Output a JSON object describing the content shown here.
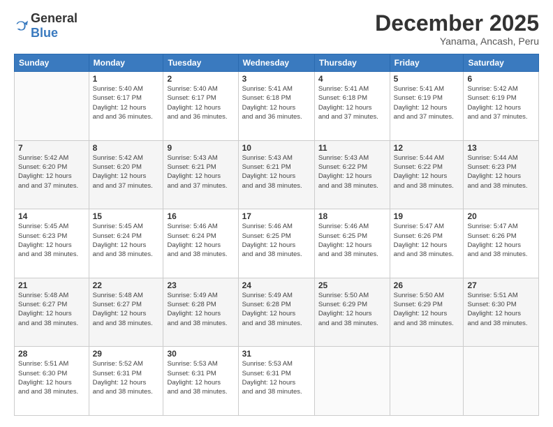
{
  "logo": {
    "general": "General",
    "blue": "Blue"
  },
  "header": {
    "month_year": "December 2025",
    "location": "Yanama, Ancash, Peru"
  },
  "weekdays": [
    "Sunday",
    "Monday",
    "Tuesday",
    "Wednesday",
    "Thursday",
    "Friday",
    "Saturday"
  ],
  "weeks": [
    [
      {
        "day": "",
        "sunrise": "",
        "sunset": "",
        "daylight": ""
      },
      {
        "day": "1",
        "sunrise": "Sunrise: 5:40 AM",
        "sunset": "Sunset: 6:17 PM",
        "daylight": "Daylight: 12 hours and 36 minutes."
      },
      {
        "day": "2",
        "sunrise": "Sunrise: 5:40 AM",
        "sunset": "Sunset: 6:17 PM",
        "daylight": "Daylight: 12 hours and 36 minutes."
      },
      {
        "day": "3",
        "sunrise": "Sunrise: 5:41 AM",
        "sunset": "Sunset: 6:18 PM",
        "daylight": "Daylight: 12 hours and 36 minutes."
      },
      {
        "day": "4",
        "sunrise": "Sunrise: 5:41 AM",
        "sunset": "Sunset: 6:18 PM",
        "daylight": "Daylight: 12 hours and 37 minutes."
      },
      {
        "day": "5",
        "sunrise": "Sunrise: 5:41 AM",
        "sunset": "Sunset: 6:19 PM",
        "daylight": "Daylight: 12 hours and 37 minutes."
      },
      {
        "day": "6",
        "sunrise": "Sunrise: 5:42 AM",
        "sunset": "Sunset: 6:19 PM",
        "daylight": "Daylight: 12 hours and 37 minutes."
      }
    ],
    [
      {
        "day": "7",
        "sunrise": "Sunrise: 5:42 AM",
        "sunset": "Sunset: 6:20 PM",
        "daylight": "Daylight: 12 hours and 37 minutes."
      },
      {
        "day": "8",
        "sunrise": "Sunrise: 5:42 AM",
        "sunset": "Sunset: 6:20 PM",
        "daylight": "Daylight: 12 hours and 37 minutes."
      },
      {
        "day": "9",
        "sunrise": "Sunrise: 5:43 AM",
        "sunset": "Sunset: 6:21 PM",
        "daylight": "Daylight: 12 hours and 37 minutes."
      },
      {
        "day": "10",
        "sunrise": "Sunrise: 5:43 AM",
        "sunset": "Sunset: 6:21 PM",
        "daylight": "Daylight: 12 hours and 38 minutes."
      },
      {
        "day": "11",
        "sunrise": "Sunrise: 5:43 AM",
        "sunset": "Sunset: 6:22 PM",
        "daylight": "Daylight: 12 hours and 38 minutes."
      },
      {
        "day": "12",
        "sunrise": "Sunrise: 5:44 AM",
        "sunset": "Sunset: 6:22 PM",
        "daylight": "Daylight: 12 hours and 38 minutes."
      },
      {
        "day": "13",
        "sunrise": "Sunrise: 5:44 AM",
        "sunset": "Sunset: 6:23 PM",
        "daylight": "Daylight: 12 hours and 38 minutes."
      }
    ],
    [
      {
        "day": "14",
        "sunrise": "Sunrise: 5:45 AM",
        "sunset": "Sunset: 6:23 PM",
        "daylight": "Daylight: 12 hours and 38 minutes."
      },
      {
        "day": "15",
        "sunrise": "Sunrise: 5:45 AM",
        "sunset": "Sunset: 6:24 PM",
        "daylight": "Daylight: 12 hours and 38 minutes."
      },
      {
        "day": "16",
        "sunrise": "Sunrise: 5:46 AM",
        "sunset": "Sunset: 6:24 PM",
        "daylight": "Daylight: 12 hours and 38 minutes."
      },
      {
        "day": "17",
        "sunrise": "Sunrise: 5:46 AM",
        "sunset": "Sunset: 6:25 PM",
        "daylight": "Daylight: 12 hours and 38 minutes."
      },
      {
        "day": "18",
        "sunrise": "Sunrise: 5:46 AM",
        "sunset": "Sunset: 6:25 PM",
        "daylight": "Daylight: 12 hours and 38 minutes."
      },
      {
        "day": "19",
        "sunrise": "Sunrise: 5:47 AM",
        "sunset": "Sunset: 6:26 PM",
        "daylight": "Daylight: 12 hours and 38 minutes."
      },
      {
        "day": "20",
        "sunrise": "Sunrise: 5:47 AM",
        "sunset": "Sunset: 6:26 PM",
        "daylight": "Daylight: 12 hours and 38 minutes."
      }
    ],
    [
      {
        "day": "21",
        "sunrise": "Sunrise: 5:48 AM",
        "sunset": "Sunset: 6:27 PM",
        "daylight": "Daylight: 12 hours and 38 minutes."
      },
      {
        "day": "22",
        "sunrise": "Sunrise: 5:48 AM",
        "sunset": "Sunset: 6:27 PM",
        "daylight": "Daylight: 12 hours and 38 minutes."
      },
      {
        "day": "23",
        "sunrise": "Sunrise: 5:49 AM",
        "sunset": "Sunset: 6:28 PM",
        "daylight": "Daylight: 12 hours and 38 minutes."
      },
      {
        "day": "24",
        "sunrise": "Sunrise: 5:49 AM",
        "sunset": "Sunset: 6:28 PM",
        "daylight": "Daylight: 12 hours and 38 minutes."
      },
      {
        "day": "25",
        "sunrise": "Sunrise: 5:50 AM",
        "sunset": "Sunset: 6:29 PM",
        "daylight": "Daylight: 12 hours and 38 minutes."
      },
      {
        "day": "26",
        "sunrise": "Sunrise: 5:50 AM",
        "sunset": "Sunset: 6:29 PM",
        "daylight": "Daylight: 12 hours and 38 minutes."
      },
      {
        "day": "27",
        "sunrise": "Sunrise: 5:51 AM",
        "sunset": "Sunset: 6:30 PM",
        "daylight": "Daylight: 12 hours and 38 minutes."
      }
    ],
    [
      {
        "day": "28",
        "sunrise": "Sunrise: 5:51 AM",
        "sunset": "Sunset: 6:30 PM",
        "daylight": "Daylight: 12 hours and 38 minutes."
      },
      {
        "day": "29",
        "sunrise": "Sunrise: 5:52 AM",
        "sunset": "Sunset: 6:31 PM",
        "daylight": "Daylight: 12 hours and 38 minutes."
      },
      {
        "day": "30",
        "sunrise": "Sunrise: 5:53 AM",
        "sunset": "Sunset: 6:31 PM",
        "daylight": "Daylight: 12 hours and 38 minutes."
      },
      {
        "day": "31",
        "sunrise": "Sunrise: 5:53 AM",
        "sunset": "Sunset: 6:31 PM",
        "daylight": "Daylight: 12 hours and 38 minutes."
      },
      {
        "day": "",
        "sunrise": "",
        "sunset": "",
        "daylight": ""
      },
      {
        "day": "",
        "sunrise": "",
        "sunset": "",
        "daylight": ""
      },
      {
        "day": "",
        "sunrise": "",
        "sunset": "",
        "daylight": ""
      }
    ]
  ]
}
